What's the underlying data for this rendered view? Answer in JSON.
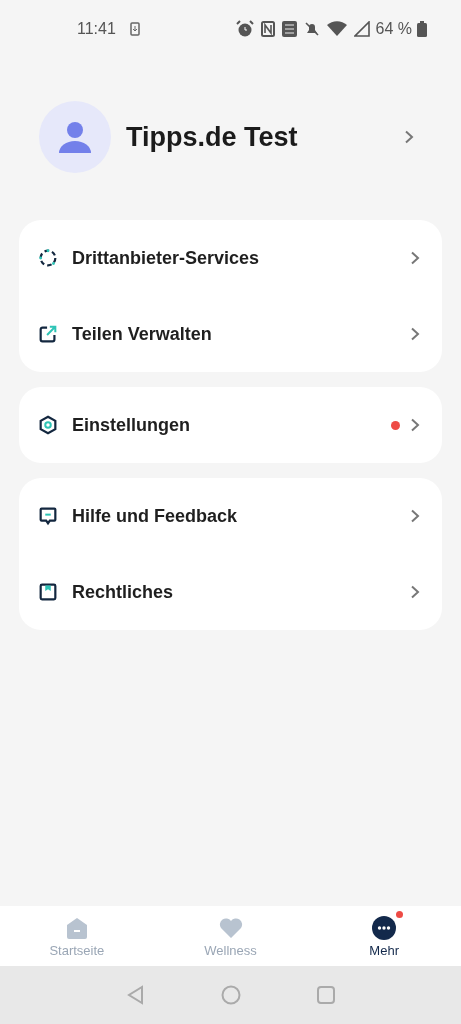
{
  "status_bar": {
    "time": "11:41",
    "battery": "64 %"
  },
  "profile": {
    "name": "Tipps.de Test"
  },
  "groups": [
    {
      "items": [
        {
          "label": "Drittanbieter-Services",
          "dot": false
        },
        {
          "label": "Teilen Verwalten",
          "dot": false
        }
      ]
    },
    {
      "items": [
        {
          "label": "Einstellungen",
          "dot": true
        }
      ]
    },
    {
      "items": [
        {
          "label": "Hilfe und Feedback",
          "dot": false
        },
        {
          "label": "Rechtliches",
          "dot": false
        }
      ]
    }
  ],
  "tabs": [
    {
      "label": "Startseite",
      "selected": false,
      "dot": false
    },
    {
      "label": "Wellness",
      "selected": false,
      "dot": false
    },
    {
      "label": "Mehr",
      "selected": true,
      "dot": true
    }
  ]
}
